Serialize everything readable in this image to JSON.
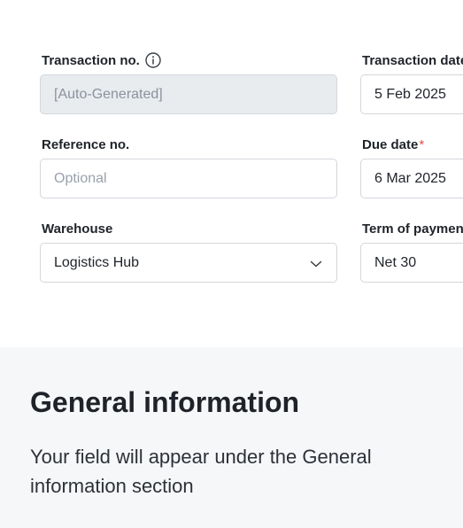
{
  "form": {
    "transaction_no": {
      "label": "Transaction no.",
      "value": "[Auto-Generated]"
    },
    "transaction_date": {
      "label": "Transaction date",
      "value": "5 Feb 2025"
    },
    "reference_no": {
      "label": "Reference no.",
      "placeholder": "Optional"
    },
    "due_date": {
      "label": "Due date",
      "required_mark": "*",
      "value": "6 Mar 2025"
    },
    "warehouse": {
      "label": "Warehouse",
      "value": "Logistics Hub"
    },
    "term_of_payment": {
      "label": "Term of payment",
      "value": "Net 30"
    }
  },
  "info_section": {
    "title": "General information",
    "description": "Your field will appear under the General information section"
  },
  "icons": {
    "info": "info-icon",
    "dropdown": "chevron-down-icon"
  },
  "colors": {
    "required": "#e5484d",
    "disabled_bg": "#e9ecef",
    "section_bg": "#f6f7f9"
  }
}
